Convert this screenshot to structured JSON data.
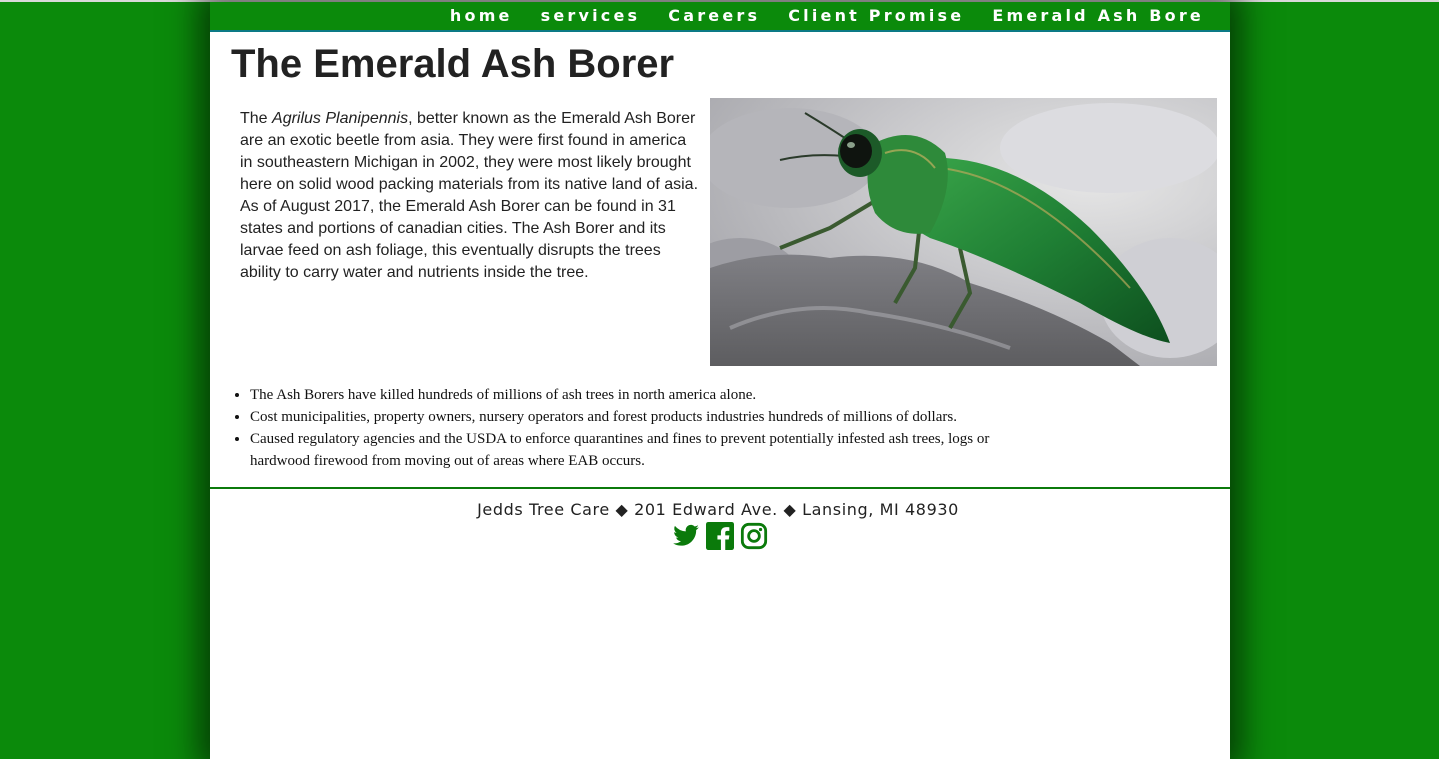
{
  "nav": {
    "items": [
      {
        "label": "home"
      },
      {
        "label": "services"
      },
      {
        "label": "Careers"
      },
      {
        "label": "Client Promise"
      },
      {
        "label": "Emerald Ash Bore"
      }
    ]
  },
  "page": {
    "title": "The Emerald Ash Borer",
    "intro": {
      "lead": "The ",
      "scientific_name": "Agrilus Planipennis",
      "body": ", better known as the Emerald Ash Borer are an exotic beetle from asia. They were first found in america in southeastern Michigan in 2002, they were most likely brought here on solid wood packing materials from its native land of asia. As of August 2017, the Emerald Ash Borer can be found in 31 states and portions of canadian cities. The Ash Borer and its larvae feed on ash foliage, this eventually disrupts the trees ability to carry water and nutrients inside the tree."
    },
    "facts": [
      "The Ash Borers have killed hundreds of millions of ash trees in north america alone.",
      "Cost municipalities, property owners, nursery operators and forest products industries hundreds of millions of dollars.",
      "Caused regulatory agencies and the USDA to enforce quarantines and fines to prevent potentially infested ash trees, logs or hardwood firewood from moving out of areas where EAB occurs."
    ]
  },
  "footer": {
    "address": "Jedds Tree Care ◆ 201 Edward Ave. ◆ Lansing, MI 48930",
    "social_icons": [
      "twitter-icon",
      "facebook-icon",
      "instagram-icon"
    ]
  },
  "colors": {
    "brand_green": "#0b8a0b",
    "nav_underline": "#0c7a86",
    "text": "#222222"
  }
}
